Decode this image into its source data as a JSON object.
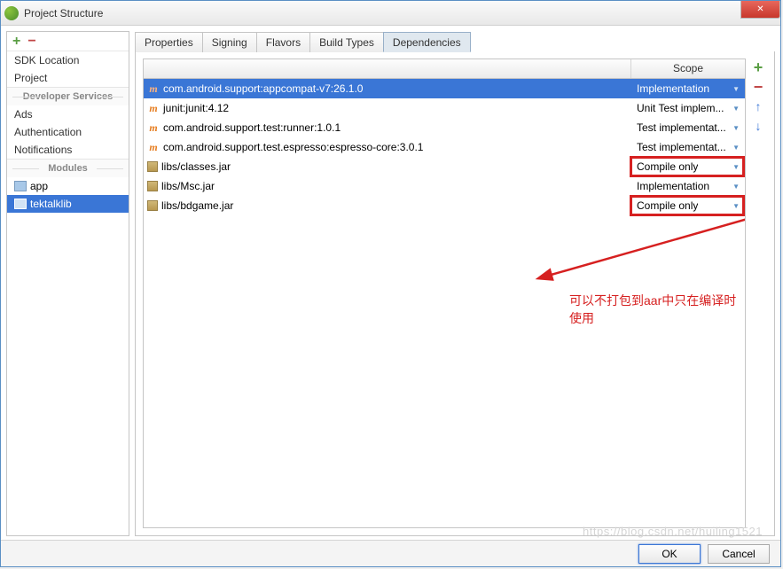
{
  "window": {
    "title": "Project Structure"
  },
  "sidebar": {
    "items": [
      {
        "label": "SDK Location"
      },
      {
        "label": "Project"
      }
    ],
    "dev_services_header": "Developer Services",
    "dev_services": [
      {
        "label": "Ads"
      },
      {
        "label": "Authentication"
      },
      {
        "label": "Notifications"
      }
    ],
    "modules_header": "Modules",
    "modules": [
      {
        "label": "app",
        "selected": false
      },
      {
        "label": "tektalklib",
        "selected": true
      }
    ]
  },
  "tabs": [
    {
      "label": "Properties",
      "active": false
    },
    {
      "label": "Signing",
      "active": false
    },
    {
      "label": "Flavors",
      "active": false
    },
    {
      "label": "Build Types",
      "active": false
    },
    {
      "label": "Dependencies",
      "active": true
    }
  ],
  "table": {
    "scope_header": "Scope",
    "rows": [
      {
        "icon": "m",
        "name": "com.android.support:appcompat-v7:26.1.0",
        "scope": "Implementation",
        "selected": true,
        "highlight": false
      },
      {
        "icon": "m",
        "name": "junit:junit:4.12",
        "scope": "Unit Test implem...",
        "selected": false,
        "highlight": false
      },
      {
        "icon": "m",
        "name": "com.android.support.test:runner:1.0.1",
        "scope": "Test implementat...",
        "selected": false,
        "highlight": false
      },
      {
        "icon": "m",
        "name": "com.android.support.test.espresso:espresso-core:3.0.1",
        "scope": "Test implementat...",
        "selected": false,
        "highlight": false
      },
      {
        "icon": "jar",
        "name": "libs/classes.jar",
        "scope": "Compile only",
        "selected": false,
        "highlight": true
      },
      {
        "icon": "jar",
        "name": "libs/Msc.jar",
        "scope": "Implementation",
        "selected": false,
        "highlight": false
      },
      {
        "icon": "jar",
        "name": "libs/bdgame.jar",
        "scope": "Compile only",
        "selected": false,
        "highlight": true
      }
    ]
  },
  "annotation_text": "可以不打包到aar中只在编译时使用",
  "footer": {
    "ok": "OK",
    "cancel": "Cancel"
  },
  "watermark": "https://blog.csdn.net/huiling1521"
}
